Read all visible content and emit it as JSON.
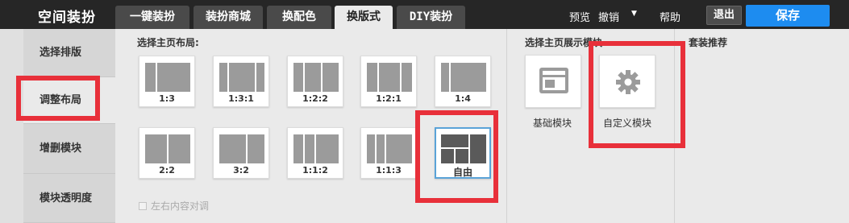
{
  "header": {
    "app_title": "空间装扮",
    "tabs": [
      {
        "label": "一键装扮"
      },
      {
        "label": "装扮商城"
      },
      {
        "label": "换配色"
      },
      {
        "label": "换版式"
      },
      {
        "label": "DIY装扮"
      }
    ],
    "active_tab": "换版式",
    "preview_label": "预览",
    "undo_label": "撤销",
    "help_label": "帮助",
    "exit_label": "退出",
    "save_label": "保存",
    "colors": {
      "save": "#1d8cf0",
      "topbar": "#262626",
      "highlight": "#e8303a",
      "selected_border": "#5aa3d8"
    }
  },
  "sidebar": {
    "items": [
      {
        "label": "选择排版"
      },
      {
        "label": "调整布局"
      },
      {
        "label": "增删模块"
      },
      {
        "label": "模块透明度"
      }
    ],
    "active_item": "调整布局"
  },
  "layout_section": {
    "title": "选择主页布局:",
    "options": [
      {
        "label": "1:3"
      },
      {
        "label": "1:3:1"
      },
      {
        "label": "1:2:2"
      },
      {
        "label": "1:2:1"
      },
      {
        "label": "1:4"
      },
      {
        "label": "2:2"
      },
      {
        "label": "3:2"
      },
      {
        "label": "1:1:2"
      },
      {
        "label": "1:1:3"
      },
      {
        "label": "自由"
      }
    ],
    "selected": "自由",
    "checkbox_label": "左右内容对调"
  },
  "module_section": {
    "title": "选择主页展示模块",
    "modules": [
      {
        "label": "基础模块",
        "icon": "window-icon"
      },
      {
        "label": "自定义模块",
        "icon": "gear-icon"
      }
    ]
  },
  "recommend_section": {
    "title": "套装推荐"
  }
}
